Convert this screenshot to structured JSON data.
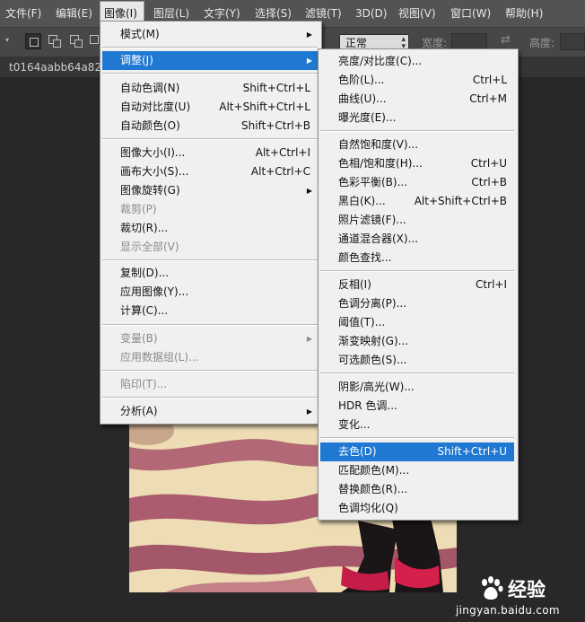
{
  "menubar": {
    "items": [
      {
        "label": "文件(F)"
      },
      {
        "label": "编辑(E)"
      },
      {
        "label": "图像(I)"
      },
      {
        "label": "图层(L)"
      },
      {
        "label": "文字(Y)"
      },
      {
        "label": "选择(S)"
      },
      {
        "label": "滤镜(T)"
      },
      {
        "label": "3D(D)"
      },
      {
        "label": "视图(V)"
      },
      {
        "label": "窗口(W)"
      },
      {
        "label": "帮助(H)"
      }
    ]
  },
  "options_bar": {
    "style_value": "正常",
    "width_label": "宽度:",
    "height_label": "高度:"
  },
  "document": {
    "tab_title": "t0164aabb64a8235"
  },
  "image_menu": {
    "items": [
      {
        "label": "模式(M)",
        "shortcut": "",
        "submenu": true,
        "disabled": false
      },
      {
        "label": "调整(J)",
        "shortcut": "",
        "submenu": true,
        "disabled": false,
        "highlighted": true
      },
      {
        "label": "自动色调(N)",
        "shortcut": "Shift+Ctrl+L",
        "submenu": false,
        "disabled": false
      },
      {
        "label": "自动对比度(U)",
        "shortcut": "Alt+Shift+Ctrl+L",
        "submenu": false,
        "disabled": false
      },
      {
        "label": "自动颜色(O)",
        "shortcut": "Shift+Ctrl+B",
        "submenu": false,
        "disabled": false
      },
      {
        "label": "图像大小(I)...",
        "shortcut": "Alt+Ctrl+I",
        "submenu": false,
        "disabled": false
      },
      {
        "label": "画布大小(S)...",
        "shortcut": "Alt+Ctrl+C",
        "submenu": false,
        "disabled": false
      },
      {
        "label": "图像旋转(G)",
        "shortcut": "",
        "submenu": true,
        "disabled": false
      },
      {
        "label": "裁剪(P)",
        "shortcut": "",
        "submenu": false,
        "disabled": true
      },
      {
        "label": "裁切(R)...",
        "shortcut": "",
        "submenu": false,
        "disabled": false
      },
      {
        "label": "显示全部(V)",
        "shortcut": "",
        "submenu": false,
        "disabled": true
      },
      {
        "label": "复制(D)...",
        "shortcut": "",
        "submenu": false,
        "disabled": false
      },
      {
        "label": "应用图像(Y)...",
        "shortcut": "",
        "submenu": false,
        "disabled": false
      },
      {
        "label": "计算(C)...",
        "shortcut": "",
        "submenu": false,
        "disabled": false
      },
      {
        "label": "变量(B)",
        "shortcut": "",
        "submenu": true,
        "disabled": true
      },
      {
        "label": "应用数据组(L)...",
        "shortcut": "",
        "submenu": false,
        "disabled": true
      },
      {
        "label": "陷印(T)...",
        "shortcut": "",
        "submenu": false,
        "disabled": true
      },
      {
        "label": "分析(A)",
        "shortcut": "",
        "submenu": true,
        "disabled": false
      }
    ]
  },
  "adjust_menu": {
    "items": [
      {
        "label": "亮度/对比度(C)...",
        "shortcut": ""
      },
      {
        "label": "色阶(L)...",
        "shortcut": "Ctrl+L"
      },
      {
        "label": "曲线(U)...",
        "shortcut": "Ctrl+M"
      },
      {
        "label": "曝光度(E)...",
        "shortcut": ""
      },
      {
        "label": "自然饱和度(V)...",
        "shortcut": ""
      },
      {
        "label": "色相/饱和度(H)...",
        "shortcut": "Ctrl+U"
      },
      {
        "label": "色彩平衡(B)...",
        "shortcut": "Ctrl+B"
      },
      {
        "label": "黑白(K)...",
        "shortcut": "Alt+Shift+Ctrl+B"
      },
      {
        "label": "照片滤镜(F)...",
        "shortcut": ""
      },
      {
        "label": "通道混合器(X)...",
        "shortcut": ""
      },
      {
        "label": "颜色查找...",
        "shortcut": ""
      },
      {
        "label": "反相(I)",
        "shortcut": "Ctrl+I"
      },
      {
        "label": "色调分离(P)...",
        "shortcut": ""
      },
      {
        "label": "阈值(T)...",
        "shortcut": ""
      },
      {
        "label": "渐变映射(G)...",
        "shortcut": ""
      },
      {
        "label": "可选颜色(S)...",
        "shortcut": ""
      },
      {
        "label": "阴影/高光(W)...",
        "shortcut": ""
      },
      {
        "label": "HDR 色调...",
        "shortcut": ""
      },
      {
        "label": "变化...",
        "shortcut": ""
      },
      {
        "label": "去色(D)",
        "shortcut": "Shift+Ctrl+U",
        "highlighted": true
      },
      {
        "label": "匹配颜色(M)...",
        "shortcut": ""
      },
      {
        "label": "替换颜色(R)...",
        "shortcut": ""
      },
      {
        "label": "色调均化(Q)",
        "shortcut": ""
      }
    ]
  },
  "watermark": {
    "word": "经验",
    "url": "jingyan.baidu.com"
  },
  "colors": {
    "menu_highlight": "#1f78d1",
    "menu_bg": "#f0f0f0",
    "app_bg": "#282828",
    "menubar_bg": "#535353"
  }
}
